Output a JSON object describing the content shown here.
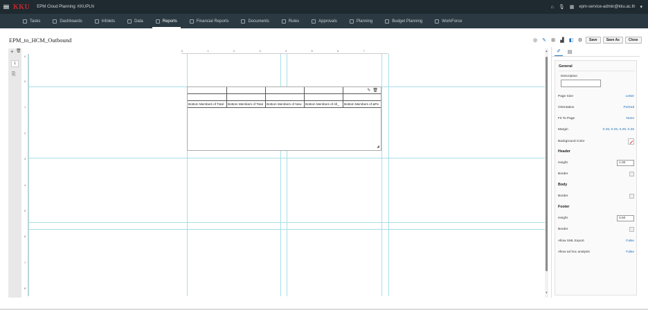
{
  "app": {
    "logo": "KKU",
    "title": "EPM Cloud Planning: KKUPLN",
    "user": "epm-service-admin@kku.ac.th"
  },
  "nav": [
    {
      "label": "Tasks",
      "icon": "tasks-icon"
    },
    {
      "label": "Dashboards",
      "icon": "dashboard-icon"
    },
    {
      "label": "Infolets",
      "icon": "infolets-icon"
    },
    {
      "label": "Data",
      "icon": "data-icon"
    },
    {
      "label": "Reports",
      "icon": "reports-icon"
    },
    {
      "label": "Financial Reports",
      "icon": "financial-reports-icon"
    },
    {
      "label": "Documents",
      "icon": "documents-icon"
    },
    {
      "label": "Rules",
      "icon": "rules-icon"
    },
    {
      "label": "Approvals",
      "icon": "approvals-icon"
    },
    {
      "label": "Planning",
      "icon": "planning-icon"
    },
    {
      "label": "Budget Planning",
      "icon": "budget-planning-icon"
    },
    {
      "label": "WorkForce",
      "icon": "workforce-icon"
    }
  ],
  "nav_active": "Reports",
  "page": {
    "title": "EPM_to_HCM_Outbound"
  },
  "toolbar": {
    "save_label": "Save",
    "save_as_label": "Save As",
    "close_label": "Close"
  },
  "rail": {
    "add": "+",
    "delete": "🗑",
    "page_number": "1"
  },
  "ruler": {
    "top": [
      "0",
      "1",
      "2",
      "3",
      "4",
      "5",
      "6",
      "7"
    ],
    "left": [
      "0",
      "0",
      "1",
      "2",
      "3",
      "4",
      "5",
      "6",
      "7",
      "8"
    ]
  },
  "grid": {
    "columns": [
      "Bottom Members of Total",
      "Bottom Members of Total",
      "Bottom Members of New",
      "Bottom Members of All_",
      "Bottom Members of &Pe"
    ]
  },
  "panel": {
    "general_header": "General",
    "description_label": "Description",
    "description_value": "",
    "page_size_label": "Page Size",
    "page_size_value": "Letter",
    "orientation_label": "Orientation",
    "orientation_value": "Portrait",
    "fit_label": "Fit To Page",
    "fit_value": "None",
    "margin_label": "Margin",
    "margin_value": "0.25, 0.25, 0.25, 0.25",
    "bg_label": "Background Color",
    "header_header": "Header",
    "header_height_label": "Height",
    "header_height_value": "1.00",
    "header_border_label": "Border",
    "body_header": "Body",
    "body_border_label": "Border",
    "footer_header": "Footer",
    "footer_height_label": "Height",
    "footer_height_value": "0.50",
    "footer_border_label": "Border",
    "xml_label": "Allow XML Export",
    "xml_value": "False",
    "adhoc_label": "Allow ad hoc analysis",
    "adhoc_value": "False"
  }
}
